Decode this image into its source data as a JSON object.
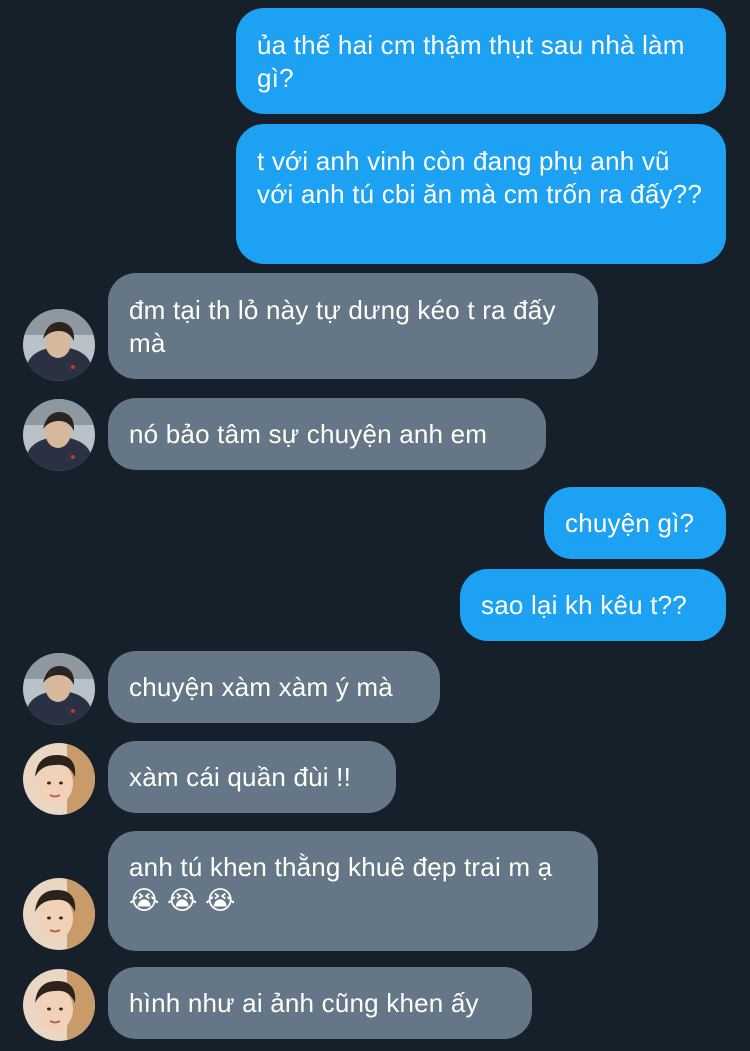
{
  "conversation": {
    "messages": [
      {
        "side": "sent",
        "text": "ủa thế hai cm thậm thụt sau nhà làm gì?"
      },
      {
        "side": "sent",
        "text": "t với anh vinh còn đang phụ anh vũ với anh tú cbi ăn mà cm trốn ra đấy??"
      },
      {
        "side": "received",
        "sender_avatar": "avatar-1",
        "text": "đm tại th lỏ này tự dưng kéo t ra đấy mà"
      },
      {
        "side": "received",
        "sender_avatar": "avatar-1",
        "text": "nó bảo tâm sự chuyện anh em"
      },
      {
        "side": "sent",
        "text": "chuyện gì?"
      },
      {
        "side": "sent",
        "text": "sao lại kh kêu t??"
      },
      {
        "side": "received",
        "sender_avatar": "avatar-1",
        "text": "chuyện xàm xàm ý mà"
      },
      {
        "side": "received",
        "sender_avatar": "avatar-2",
        "text": "xàm cái quần đùi !!"
      },
      {
        "side": "received",
        "sender_avatar": "avatar-2",
        "text": "anh tú khen thằng khuê đẹp trai m ạ 😭 😭 😭"
      },
      {
        "side": "received",
        "sender_avatar": "avatar-2",
        "text": "hình như ai ảnh cũng khen ấy"
      }
    ]
  },
  "colors": {
    "background": "#15202b",
    "sent_bubble": "#1da1f2",
    "received_bubble": "#657786",
    "text": "#ffffff"
  }
}
